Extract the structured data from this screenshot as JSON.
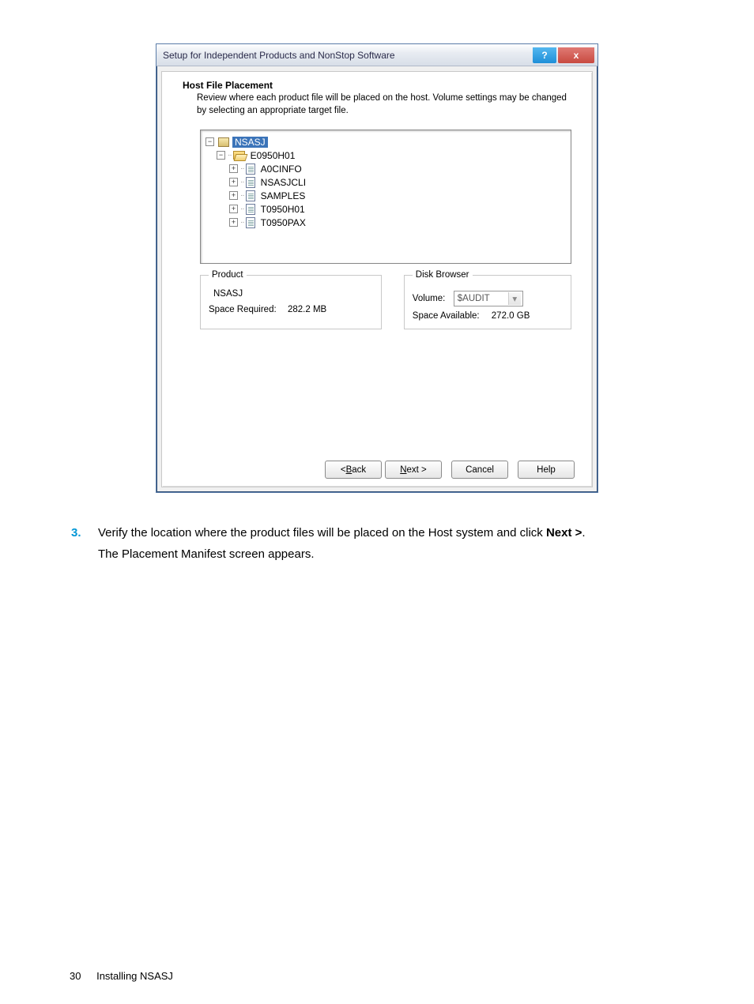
{
  "dialog": {
    "title": "Setup for Independent Products and NonStop Software",
    "header": {
      "title": "Host File Placement",
      "description": "Review where each product file will be placed on the host.  Volume settings may be changed by selecting an appropriate target file."
    },
    "tree": {
      "root": {
        "label": "NSASJ",
        "expanded": true,
        "selected": true
      },
      "folder": {
        "label": "E0950H01",
        "expanded": true
      },
      "items": [
        {
          "label": "A0CINFO"
        },
        {
          "label": "NSASJCLI"
        },
        {
          "label": "SAMPLES"
        },
        {
          "label": "T0950H01"
        },
        {
          "label": "T0950PAX"
        }
      ]
    },
    "product": {
      "legend": "Product",
      "name": "NSASJ",
      "space_required_label": "Space Required:",
      "space_required_value": "282.2 MB"
    },
    "disk": {
      "legend": "Disk Browser",
      "volume_label": "Volume:",
      "volume_value": "$AUDIT",
      "space_available_label": "Space Available:",
      "space_available_value": "272.0 GB"
    },
    "buttons": {
      "back": "< Back",
      "next": "Next >",
      "cancel": "Cancel",
      "help": "Help"
    },
    "titlebar_help": "?",
    "titlebar_close": "x"
  },
  "step": {
    "number": "3.",
    "text_before": "Verify the location where the product files will be placed on the Host system and click ",
    "text_bold": "Next >",
    "text_after": ".",
    "followup_before": "The ",
    "followup_bold": "Placement Manifest",
    "followup_after": " screen appears."
  },
  "footer": {
    "page_number": "30",
    "section": "Installing NSASJ"
  }
}
